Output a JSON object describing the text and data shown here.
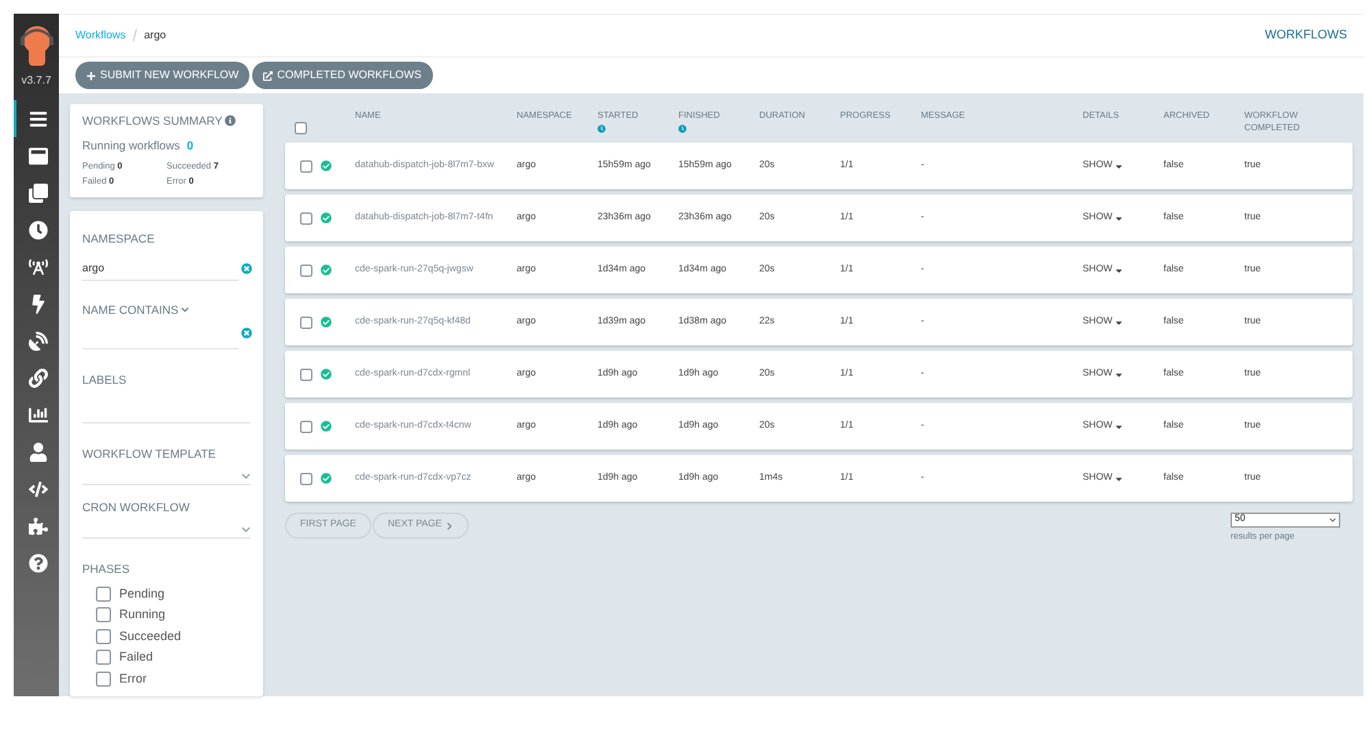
{
  "sidebar": {
    "version": "v3.7.7",
    "items": [
      {
        "selected": true
      },
      {
        "selected": false
      },
      {
        "selected": false
      },
      {
        "selected": false
      },
      {
        "selected": false
      },
      {
        "selected": false
      },
      {
        "selected": false
      },
      {
        "selected": false
      },
      {
        "selected": false
      },
      {
        "selected": false
      },
      {
        "selected": false
      },
      {
        "selected": false
      },
      {
        "selected": false
      }
    ]
  },
  "breadcrumbs": [
    "Workflows",
    "argo"
  ],
  "breadcrumb_separator": "/",
  "page_title": "WORKFLOWS",
  "toolbar": [
    {
      "label": "SUBMIT NEW WORKFLOW",
      "kind": "plus"
    },
    {
      "label": "COMPLETED WORKFLOWS",
      "kind": "external"
    }
  ],
  "summary": {
    "title": "WORKFLOWS SUMMARY",
    "running_label": "Running workflows",
    "running": "0",
    "counts": [
      {
        "label": "Pending",
        "value": "0"
      },
      {
        "label": "Succeeded",
        "value": "7"
      },
      {
        "label": "Failed",
        "value": "0"
      },
      {
        "label": "Error",
        "value": "0"
      }
    ]
  },
  "filters": {
    "namespace": {
      "label": "NAMESPACE",
      "value": "argo"
    },
    "name_contains": {
      "label": "NAME CONTAINS"
    },
    "labels": {
      "label": "LABELS"
    },
    "workflow_template": {
      "label": "WORKFLOW TEMPLATE"
    },
    "cron_workflow": {
      "label": "CRON WORKFLOW"
    },
    "phases": {
      "label": "PHASES",
      "items": [
        {
          "label": "Pending",
          "checked": false
        },
        {
          "label": "Running",
          "checked": false
        },
        {
          "label": "Succeeded",
          "checked": false
        },
        {
          "label": "Failed",
          "checked": false
        },
        {
          "label": "Error",
          "checked": false
        }
      ]
    }
  },
  "table": {
    "select_all_checked": false,
    "columns": [
      {
        "label": "NAME"
      },
      {
        "label": "NAMESPACE"
      },
      {
        "label": "STARTED",
        "sortable": true
      },
      {
        "label": "FINISHED",
        "sortable": true
      },
      {
        "label": "DURATION"
      },
      {
        "label": "PROGRESS"
      },
      {
        "label": "MESSAGE"
      },
      {
        "label": "DETAILS"
      },
      {
        "label": "ARCHIVED"
      },
      {
        "label": "WORKFLOW COMPLETED"
      }
    ],
    "rows": [
      {
        "checked": false,
        "color": "#18be94",
        "name": "datahub-dispatch-job-8l7m7-bxw",
        "namespace": "argo",
        "started": "15h59m ago",
        "finished": "15h59m ago",
        "duration": "20s",
        "progress": "1/1",
        "message": "-",
        "details": "SHOW",
        "archived": "false",
        "completed": "true"
      },
      {
        "checked": false,
        "color": "#18be94",
        "name": "datahub-dispatch-job-8l7m7-t4fn",
        "namespace": "argo",
        "started": "23h36m ago",
        "finished": "23h36m ago",
        "duration": "20s",
        "progress": "1/1",
        "message": "-",
        "details": "SHOW",
        "archived": "false",
        "completed": "true"
      },
      {
        "checked": false,
        "color": "#18be94",
        "name": "cde-spark-run-27q5q-jwgsw",
        "namespace": "argo",
        "started": "1d34m ago",
        "finished": "1d34m ago",
        "duration": "20s",
        "progress": "1/1",
        "message": "-",
        "details": "SHOW",
        "archived": "false",
        "completed": "true"
      },
      {
        "checked": false,
        "color": "#18be94",
        "name": "cde-spark-run-27q5q-kf48d",
        "namespace": "argo",
        "started": "1d39m ago",
        "finished": "1d38m ago",
        "duration": "22s",
        "progress": "1/1",
        "message": "-",
        "details": "SHOW",
        "archived": "false",
        "completed": "true"
      },
      {
        "checked": false,
        "color": "#18be94",
        "name": "cde-spark-run-d7cdx-rgmnl",
        "namespace": "argo",
        "started": "1d9h ago",
        "finished": "1d9h ago",
        "duration": "20s",
        "progress": "1/1",
        "message": "-",
        "details": "SHOW",
        "archived": "false",
        "completed": "true"
      },
      {
        "checked": false,
        "color": "#18be94",
        "name": "cde-spark-run-d7cdx-t4cnw",
        "namespace": "argo",
        "started": "1d9h ago",
        "finished": "1d9h ago",
        "duration": "20s",
        "progress": "1/1",
        "message": "-",
        "details": "SHOW",
        "archived": "false",
        "completed": "true"
      },
      {
        "checked": false,
        "color": "#18be94",
        "name": "cde-spark-run-d7cdx-vp7cz",
        "namespace": "argo",
        "started": "1d9h ago",
        "finished": "1d9h ago",
        "duration": "1m4s",
        "progress": "1/1",
        "message": "-",
        "details": "SHOW",
        "archived": "false",
        "completed": "true"
      }
    ]
  },
  "pagination": {
    "first": "FIRST PAGE",
    "next": "NEXT PAGE",
    "page_size": "50",
    "page_size_label": "results per page"
  }
}
